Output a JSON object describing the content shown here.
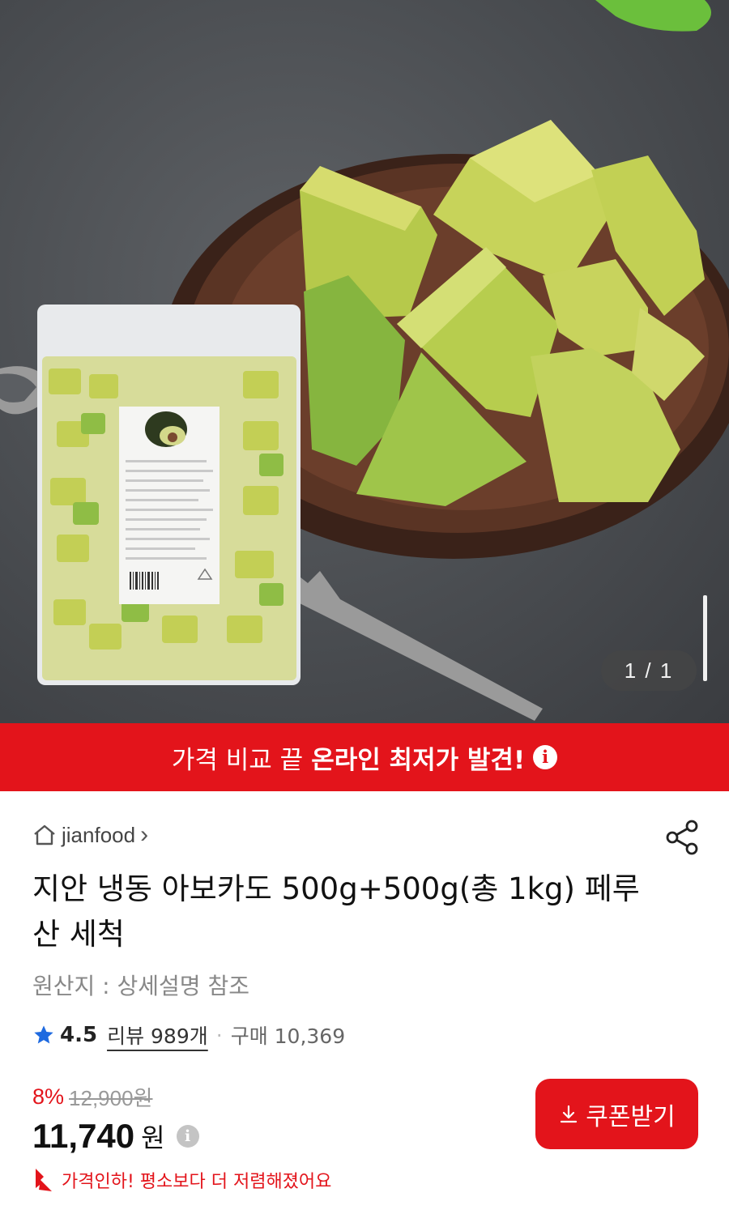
{
  "gallery": {
    "page_indicator": "1 / 1",
    "package_label": "AVOCADO"
  },
  "banner": {
    "text_normal": "가격 비교 끝 ",
    "text_strong": "온라인 최저가 발견!",
    "info_glyph": "i"
  },
  "seller": {
    "name": "jianfood",
    "chevron": "›"
  },
  "product": {
    "title": "지안 냉동 아보카도 500g+500g(총 1kg) 페루산 세척",
    "origin": "원산지 : 상세설명 참조"
  },
  "rating": {
    "score": "4.5",
    "reviews": "리뷰 989개",
    "separator": "·",
    "purchases": "구매 10,369"
  },
  "price": {
    "discount_rate": "8%",
    "original_price": "12,900원",
    "sale_price": "11,740",
    "sale_unit": "원",
    "info_glyph": "i",
    "lowest_text": "가격인하! 평소보다 더 저렴해졌어요"
  },
  "coupon": {
    "label": "쿠폰받기"
  },
  "colors": {
    "accent": "#e3141b",
    "star": "#1e6ae0"
  }
}
